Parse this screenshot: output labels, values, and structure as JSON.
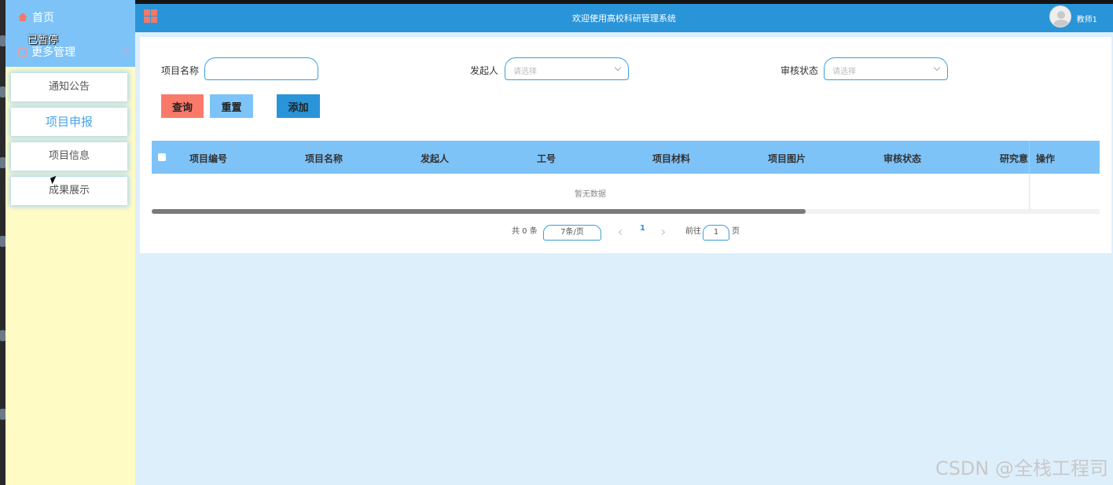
{
  "sidebar": {
    "home_label": "首页",
    "paused_label": "已暂停",
    "more_label": "更多管理",
    "items": [
      {
        "label": "通知公告"
      },
      {
        "label": "项目申报"
      },
      {
        "label": "项目信息"
      },
      {
        "label": "成果展示"
      }
    ],
    "active_index": 1
  },
  "header": {
    "title": "欢迎使用高校科研管理系统",
    "username": "教师1"
  },
  "search": {
    "name_label": "项目名称",
    "name_value": "",
    "initiator_label": "发起人",
    "initiator_placeholder": "请选择",
    "status_label": "审核状态",
    "status_placeholder": "请选择",
    "query_button": "查询",
    "reset_button": "重置",
    "add_button": "添加"
  },
  "table": {
    "columns": [
      "项目编号",
      "项目名称",
      "发起人",
      "工号",
      "项目材料",
      "项目图片",
      "审核状态",
      "研究意",
      "操作"
    ],
    "empty_text": "暂无数据",
    "horizontal_scroll_fraction": 0.69
  },
  "pagination": {
    "total_text": "共 0 条",
    "page_size": "7条/页",
    "current_page": "1",
    "goto_label": "前往",
    "goto_value": "1",
    "page_suffix": "页"
  },
  "watermark": "CSDN @全栈工程司",
  "colors": {
    "header_bg": "#2a94d8",
    "sidebar_top": "#7ec3f8",
    "sidebar_bg": "#fffbc4",
    "query_btn": "#fa7a6a",
    "reset_btn": "#7ec3f8",
    "add_btn": "#2a94d8",
    "table_header": "#7ec3f8",
    "main_bg": "#deeffc"
  }
}
